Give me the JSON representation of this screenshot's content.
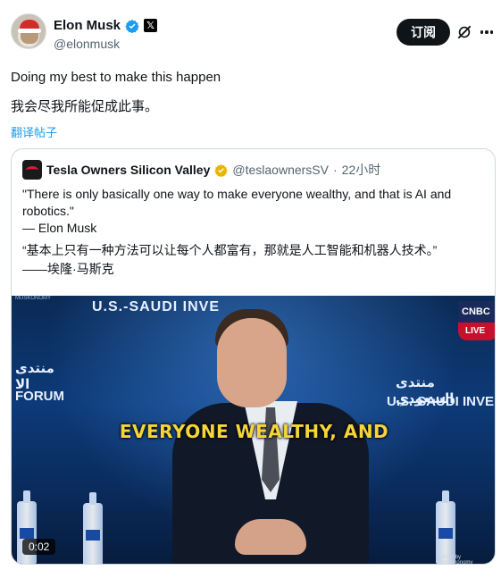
{
  "author": {
    "name": "Elon Musk",
    "handle": "@elonmusk",
    "verified_icon": "verified-badge-icon",
    "affiliation_icon": "x-logo-icon",
    "x_glyph": "𝕏"
  },
  "actions": {
    "subscribe_label": "订阅",
    "grok_icon": "grok-icon",
    "more_icon": "more-icon"
  },
  "tweet": {
    "text_en": "Doing my best to make this happen",
    "text_zh": "我会尽我所能促成此事。",
    "translate_label": "翻译帖子"
  },
  "quote": {
    "author_name": "Tesla Owners Silicon Valley",
    "author_handle": "@teslaownersSV",
    "separator": "·",
    "time": "22小时",
    "text_en": "\"There is only basically one way to make everyone wealthy, and that is AI and robotics.\"",
    "attribution_en": "— Elon Musk",
    "text_zh": "“基本上只有一种方法可以让每个人都富有，那就是人工智能和机器人技术。”",
    "attribution_zh": "——埃隆·马斯克",
    "video": {
      "caption": "EVERYONE WEALTHY, AND",
      "duration": "0:02",
      "banner_top": "U.S.-SAUDI INVE",
      "banner_left_ar": "منتدى الا",
      "banner_left_en": "FORUM",
      "banner_right_ar": "منتدى السعودي",
      "banner_right_en": "U.S.-SAUDI INVE",
      "channel_logo": "CNBC",
      "live_label": "LIVE",
      "credit": "Edited by @muskonomy",
      "watermark": "MUSKONOMY"
    }
  },
  "colors": {
    "text_primary": "#0f1419",
    "text_secondary": "#536471",
    "link": "#1d9bf0",
    "verified_blue": "#1d9bf0",
    "verified_gold": "#e8b500",
    "caption_yellow": "#f5d53a"
  }
}
